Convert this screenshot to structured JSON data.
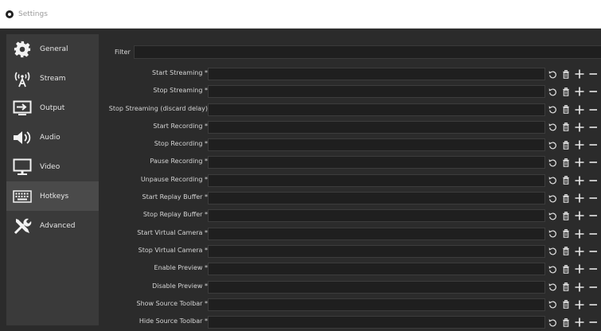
{
  "window": {
    "title": "Settings"
  },
  "sidebar": {
    "items": [
      {
        "label": "General",
        "icon": "gear-icon"
      },
      {
        "label": "Stream",
        "icon": "broadcast-icon"
      },
      {
        "label": "Output",
        "icon": "output-icon"
      },
      {
        "label": "Audio",
        "icon": "speaker-icon"
      },
      {
        "label": "Video",
        "icon": "monitor-icon"
      },
      {
        "label": "Hotkeys",
        "icon": "keyboard-icon",
        "active": true
      },
      {
        "label": "Advanced",
        "icon": "tools-icon"
      }
    ]
  },
  "filter": {
    "label": "Filter",
    "value": ""
  },
  "hotkeys": {
    "actions": [
      "revert-icon",
      "delete-icon",
      "add-icon",
      "remove-icon"
    ],
    "rows": [
      {
        "label": "Start Streaming *",
        "value": ""
      },
      {
        "label": "Stop Streaming *",
        "value": ""
      },
      {
        "label": "Stop Streaming (discard delay)",
        "value": ""
      },
      {
        "label": "Start Recording *",
        "value": ""
      },
      {
        "label": "Stop Recording *",
        "value": ""
      },
      {
        "label": "Pause Recording *",
        "value": ""
      },
      {
        "label": "Unpause Recording *",
        "value": ""
      },
      {
        "label": "Start Replay Buffer *",
        "value": ""
      },
      {
        "label": "Stop Replay Buffer *",
        "value": ""
      },
      {
        "label": "Start Virtual Camera *",
        "value": ""
      },
      {
        "label": "Stop Virtual Camera *",
        "value": ""
      },
      {
        "label": "Enable Preview *",
        "value": ""
      },
      {
        "label": "Disable Preview *",
        "value": ""
      },
      {
        "label": "Show Source Toolbar *",
        "value": ""
      },
      {
        "label": "Hide Source Toolbar *",
        "value": ""
      }
    ]
  }
}
